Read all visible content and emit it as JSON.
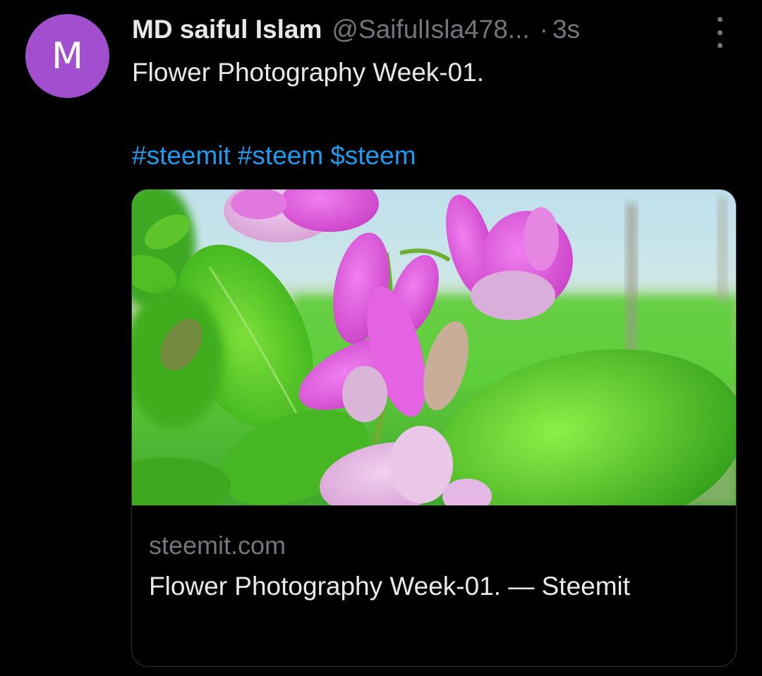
{
  "post": {
    "avatar_letter": "M",
    "display_name": "MD saiful Islam",
    "handle": "@SaifulIsla478...",
    "separator": "·",
    "time": "3s",
    "text": "Flower Photography Week-01.",
    "hashtags": [
      "#steemit",
      "#steem",
      "$steem"
    ]
  },
  "card": {
    "domain": "steemit.com",
    "title": "Flower Photography Week-01. — Steemit"
  },
  "icons": {
    "more": "more-vertical-icon"
  },
  "colors": {
    "background": "#000000",
    "avatar": "#a24fcf",
    "link": "#1d9bf0",
    "primary_text": "#e7e9ea",
    "secondary_text": "#71767b",
    "border": "#2f3336"
  }
}
